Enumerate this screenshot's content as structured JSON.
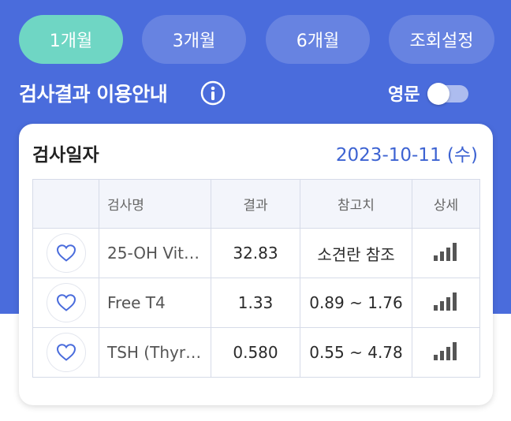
{
  "period_tabs": [
    {
      "label": "1개월",
      "active": true
    },
    {
      "label": "3개월",
      "active": false
    },
    {
      "label": "6개월",
      "active": false
    },
    {
      "label": "조회설정",
      "active": false
    }
  ],
  "guide": {
    "title": "검사결과 이용안내",
    "info_icon": "info-icon",
    "english_label": "영문",
    "english_toggle_on": false
  },
  "card": {
    "label": "검사일자",
    "date": "2023-10-11 (수)",
    "columns": [
      "검사명",
      "결과",
      "참고치",
      "상세"
    ],
    "rows": [
      {
        "name": "25-OH Vit…",
        "result": "32.83",
        "reference": "소견란 참조"
      },
      {
        "name": "Free T4",
        "result": "1.33",
        "reference": "0.89 ~ 1.76"
      },
      {
        "name": "TSH (Thyr…",
        "result": "0.580",
        "reference": "0.55 ~ 4.78"
      }
    ]
  },
  "colors": {
    "header_bg": "#4a6cdc",
    "active_tab": "#6fd6c4",
    "date_text": "#3d63d2",
    "heart_stroke": "#4a6cdc"
  }
}
